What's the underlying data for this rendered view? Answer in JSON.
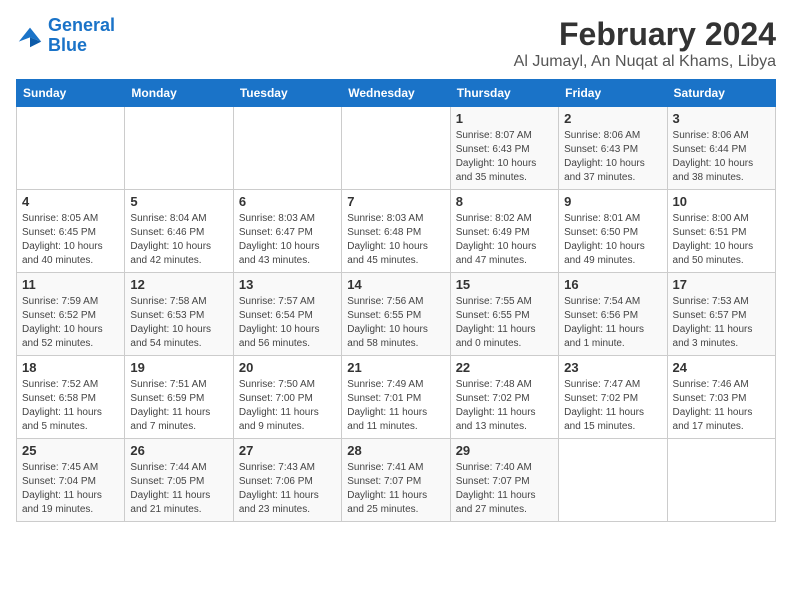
{
  "header": {
    "logo_line1": "General",
    "logo_line2": "Blue",
    "title": "February 2024",
    "subtitle": "Al Jumayl, An Nuqat al Khams, Libya"
  },
  "weekdays": [
    "Sunday",
    "Monday",
    "Tuesday",
    "Wednesday",
    "Thursday",
    "Friday",
    "Saturday"
  ],
  "weeks": [
    [
      {
        "day": "",
        "info": ""
      },
      {
        "day": "",
        "info": ""
      },
      {
        "day": "",
        "info": ""
      },
      {
        "day": "",
        "info": ""
      },
      {
        "day": "1",
        "info": "Sunrise: 8:07 AM\nSunset: 6:43 PM\nDaylight: 10 hours\nand 35 minutes."
      },
      {
        "day": "2",
        "info": "Sunrise: 8:06 AM\nSunset: 6:43 PM\nDaylight: 10 hours\nand 37 minutes."
      },
      {
        "day": "3",
        "info": "Sunrise: 8:06 AM\nSunset: 6:44 PM\nDaylight: 10 hours\nand 38 minutes."
      }
    ],
    [
      {
        "day": "4",
        "info": "Sunrise: 8:05 AM\nSunset: 6:45 PM\nDaylight: 10 hours\nand 40 minutes."
      },
      {
        "day": "5",
        "info": "Sunrise: 8:04 AM\nSunset: 6:46 PM\nDaylight: 10 hours\nand 42 minutes."
      },
      {
        "day": "6",
        "info": "Sunrise: 8:03 AM\nSunset: 6:47 PM\nDaylight: 10 hours\nand 43 minutes."
      },
      {
        "day": "7",
        "info": "Sunrise: 8:03 AM\nSunset: 6:48 PM\nDaylight: 10 hours\nand 45 minutes."
      },
      {
        "day": "8",
        "info": "Sunrise: 8:02 AM\nSunset: 6:49 PM\nDaylight: 10 hours\nand 47 minutes."
      },
      {
        "day": "9",
        "info": "Sunrise: 8:01 AM\nSunset: 6:50 PM\nDaylight: 10 hours\nand 49 minutes."
      },
      {
        "day": "10",
        "info": "Sunrise: 8:00 AM\nSunset: 6:51 PM\nDaylight: 10 hours\nand 50 minutes."
      }
    ],
    [
      {
        "day": "11",
        "info": "Sunrise: 7:59 AM\nSunset: 6:52 PM\nDaylight: 10 hours\nand 52 minutes."
      },
      {
        "day": "12",
        "info": "Sunrise: 7:58 AM\nSunset: 6:53 PM\nDaylight: 10 hours\nand 54 minutes."
      },
      {
        "day": "13",
        "info": "Sunrise: 7:57 AM\nSunset: 6:54 PM\nDaylight: 10 hours\nand 56 minutes."
      },
      {
        "day": "14",
        "info": "Sunrise: 7:56 AM\nSunset: 6:55 PM\nDaylight: 10 hours\nand 58 minutes."
      },
      {
        "day": "15",
        "info": "Sunrise: 7:55 AM\nSunset: 6:55 PM\nDaylight: 11 hours\nand 0 minutes."
      },
      {
        "day": "16",
        "info": "Sunrise: 7:54 AM\nSunset: 6:56 PM\nDaylight: 11 hours\nand 1 minute."
      },
      {
        "day": "17",
        "info": "Sunrise: 7:53 AM\nSunset: 6:57 PM\nDaylight: 11 hours\nand 3 minutes."
      }
    ],
    [
      {
        "day": "18",
        "info": "Sunrise: 7:52 AM\nSunset: 6:58 PM\nDaylight: 11 hours\nand 5 minutes."
      },
      {
        "day": "19",
        "info": "Sunrise: 7:51 AM\nSunset: 6:59 PM\nDaylight: 11 hours\nand 7 minutes."
      },
      {
        "day": "20",
        "info": "Sunrise: 7:50 AM\nSunset: 7:00 PM\nDaylight: 11 hours\nand 9 minutes."
      },
      {
        "day": "21",
        "info": "Sunrise: 7:49 AM\nSunset: 7:01 PM\nDaylight: 11 hours\nand 11 minutes."
      },
      {
        "day": "22",
        "info": "Sunrise: 7:48 AM\nSunset: 7:02 PM\nDaylight: 11 hours\nand 13 minutes."
      },
      {
        "day": "23",
        "info": "Sunrise: 7:47 AM\nSunset: 7:02 PM\nDaylight: 11 hours\nand 15 minutes."
      },
      {
        "day": "24",
        "info": "Sunrise: 7:46 AM\nSunset: 7:03 PM\nDaylight: 11 hours\nand 17 minutes."
      }
    ],
    [
      {
        "day": "25",
        "info": "Sunrise: 7:45 AM\nSunset: 7:04 PM\nDaylight: 11 hours\nand 19 minutes."
      },
      {
        "day": "26",
        "info": "Sunrise: 7:44 AM\nSunset: 7:05 PM\nDaylight: 11 hours\nand 21 minutes."
      },
      {
        "day": "27",
        "info": "Sunrise: 7:43 AM\nSunset: 7:06 PM\nDaylight: 11 hours\nand 23 minutes."
      },
      {
        "day": "28",
        "info": "Sunrise: 7:41 AM\nSunset: 7:07 PM\nDaylight: 11 hours\nand 25 minutes."
      },
      {
        "day": "29",
        "info": "Sunrise: 7:40 AM\nSunset: 7:07 PM\nDaylight: 11 hours\nand 27 minutes."
      },
      {
        "day": "",
        "info": ""
      },
      {
        "day": "",
        "info": ""
      }
    ]
  ]
}
